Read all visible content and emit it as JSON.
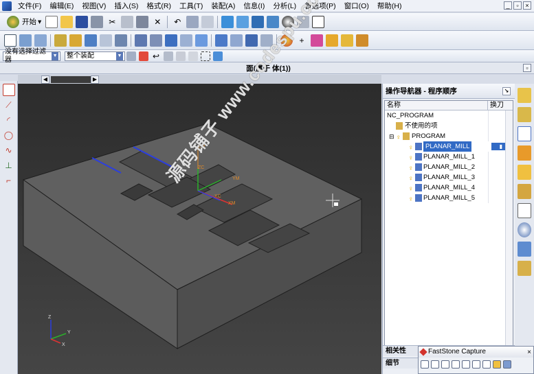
{
  "menubar": {
    "items": [
      {
        "label": "文件(F)"
      },
      {
        "label": "编辑(E)"
      },
      {
        "label": "视图(V)"
      },
      {
        "label": "插入(S)"
      },
      {
        "label": "格式(R)"
      },
      {
        "label": "工具(T)"
      },
      {
        "label": "装配(A)"
      },
      {
        "label": "信息(I)"
      },
      {
        "label": "分析(L)"
      },
      {
        "label": "首选项(P)"
      },
      {
        "label": "窗口(O)"
      },
      {
        "label": "帮助(H)"
      }
    ]
  },
  "toolbar1": {
    "start_label": "开始"
  },
  "toolbar3": {
    "filter_select": "没有选择过滤器",
    "assembly_select": "整个装配"
  },
  "status": {
    "title": "面(属于 体(1))"
  },
  "viewport": {
    "labels": {
      "zm": "ZM",
      "zc": "ZC",
      "ym": "YM",
      "xc": "XC",
      "xm": "XM",
      "triad_z": "Z",
      "triad_y": "Y",
      "triad_x": "X"
    }
  },
  "navigator": {
    "title": "操作导航器 - 程序顺序",
    "columns": {
      "name": "名称",
      "tool": "换刀"
    },
    "rows": [
      {
        "label": "NC_PROGRAM",
        "indent": 0
      },
      {
        "label": "不使用的项",
        "indent": 1
      },
      {
        "label": "PROGRAM",
        "indent": 1
      },
      {
        "label": "PLANAR_MILL",
        "indent": 2,
        "selected": true
      },
      {
        "label": "PLANAR_MILL_1",
        "indent": 2
      },
      {
        "label": "PLANAR_MILL_2",
        "indent": 2
      },
      {
        "label": "PLANAR_MILL_3",
        "indent": 2
      },
      {
        "label": "PLANAR_MILL_4",
        "indent": 2
      },
      {
        "label": "PLANAR_MILL_5",
        "indent": 2
      }
    ],
    "section_related": "相关性",
    "section_details": "细节"
  },
  "faststone": {
    "title": "FastStone Capture",
    "close": "×"
  },
  "watermark": {
    "text": "源码铺子 www.codespu.com"
  }
}
